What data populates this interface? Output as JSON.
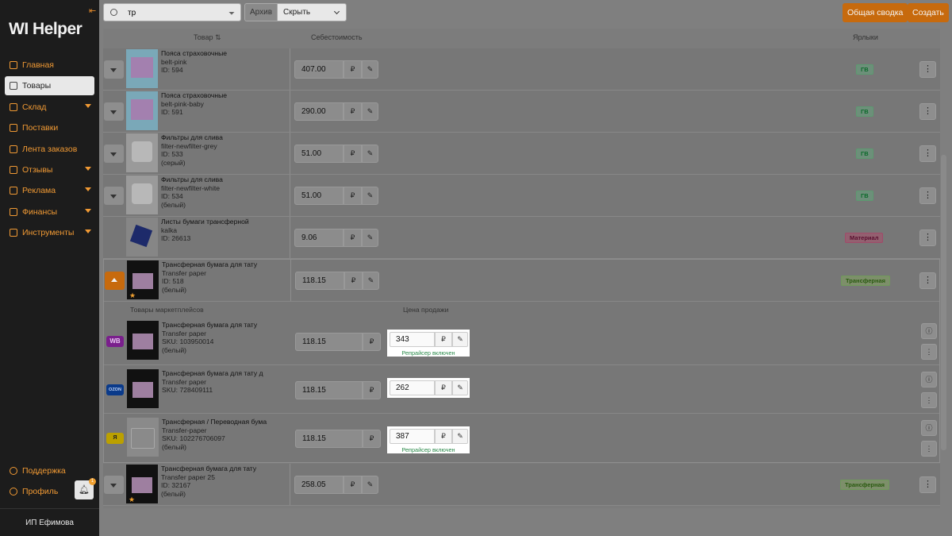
{
  "sidebar": {
    "logo": "WI Helper",
    "items": [
      {
        "label": "Главная"
      },
      {
        "label": "Товары"
      },
      {
        "label": "Склад"
      },
      {
        "label": "Поставки"
      },
      {
        "label": "Лента заказов"
      },
      {
        "label": "Отзывы"
      },
      {
        "label": "Реклама"
      },
      {
        "label": "Финансы"
      },
      {
        "label": "Инструменты"
      }
    ],
    "support": "Поддержка",
    "profile": "Профиль",
    "notifications": "1",
    "user": "ИП Ефимова"
  },
  "topbar": {
    "search_value": "тр",
    "archive_label": "Архив",
    "archive_value": "Скрыть",
    "summary_button": "Общая сводка",
    "create_button": "Создать"
  },
  "table": {
    "headers": {
      "product": "Товар ⇅",
      "cost": "Себестоимость",
      "labels": "Ярлыки"
    },
    "rows": [
      {
        "name": "Пояса страховочные",
        "sku": "belt-pink",
        "id": "ID: 594",
        "extra": "",
        "cost": "407.00",
        "tag": "ГВ"
      },
      {
        "name": "Пояса страховочные",
        "sku": "belt-pink-baby",
        "id": "ID: 591",
        "extra": "",
        "cost": "290.00",
        "tag": "ГВ"
      },
      {
        "name": "Фильтры для слива",
        "sku": "filter-newfilter-grey",
        "id": "ID: 533",
        "extra": "(серый)",
        "cost": "51.00",
        "tag": "ГВ"
      },
      {
        "name": "Фильтры для слива",
        "sku": "filter-newfilter-white",
        "id": "ID: 534",
        "extra": "(белый)",
        "cost": "51.00",
        "tag": "ГВ"
      },
      {
        "name": "Листы бумаги трансферной",
        "sku": "kalka",
        "id": "ID: 26613",
        "extra": "",
        "cost": "9.06",
        "tag": "Материал"
      },
      {
        "name": "Трансферная бумага для тату",
        "sku": "Transfer paper",
        "id": "ID: 518",
        "extra": "(белый)",
        "cost": "118.15",
        "tag": "Трансферная"
      }
    ],
    "currency": "₽",
    "subheaders": {
      "marketplace": "Товары маркетплейсов",
      "price": "Цена продажи"
    },
    "marketplace_rows": [
      {
        "badge": "WB",
        "name": "Трансферная бумага для тату",
        "sku": "Transfer paper",
        "id": "SKU: 103950014",
        "extra": "(белый)",
        "cost": "118.15",
        "price": "343",
        "repricer": "Репрайсер включен"
      },
      {
        "badge": "OZON",
        "name": "Трансферная бумага для тату д",
        "sku": "Transfer paper",
        "id": "SKU: 728409111",
        "extra": "",
        "cost": "118.15",
        "price": "262",
        "repricer": ""
      },
      {
        "badge": "Я",
        "name": "Трансферная / Переводная бума",
        "sku": "Transfer-paper",
        "id": "SKU: 102276706097",
        "extra": "(белый)",
        "cost": "118.15",
        "price": "387",
        "repricer": "Репрайсер включен"
      }
    ],
    "last_row": {
      "name": "Трансферная бумага для тату",
      "sku": "Transfer paper 25",
      "id": "ID: 32167",
      "extra": "(белый)",
      "cost": "258.05",
      "tag": "Трансферная"
    }
  },
  "colors": {
    "accent": "#f19a34",
    "button": "#c76a0d",
    "sidebar": "#1c1c1c"
  }
}
